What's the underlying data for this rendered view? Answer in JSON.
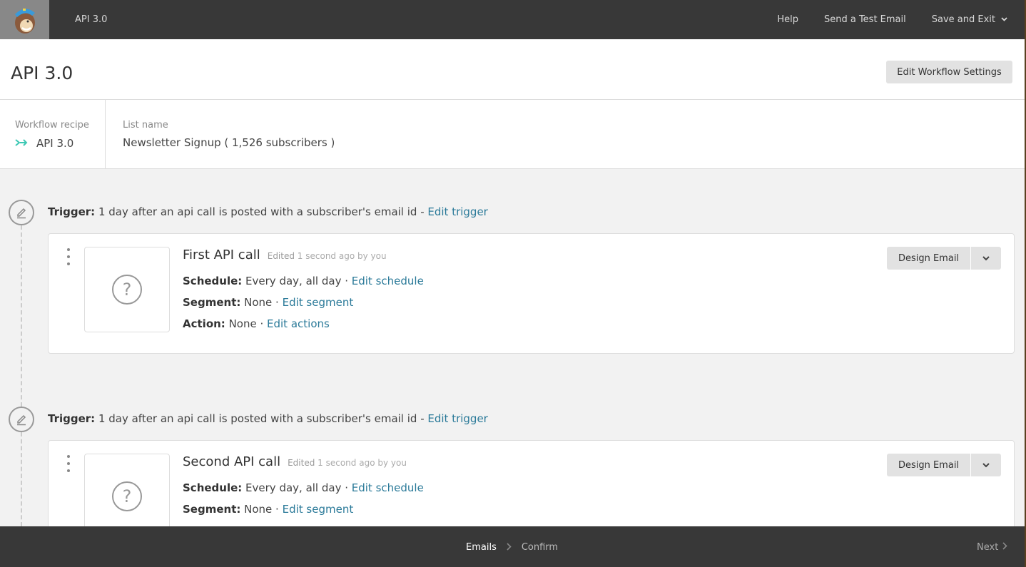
{
  "topbar": {
    "title": "API 3.0",
    "help": "Help",
    "send_test": "Send a Test Email",
    "save_exit": "Save and Exit",
    "save_exit_icon": "chevron-down-icon"
  },
  "header": {
    "title": "API 3.0",
    "edit_settings": "Edit Workflow Settings"
  },
  "info": {
    "recipe_label": "Workflow recipe",
    "recipe_value": "API 3.0",
    "list_label": "List name",
    "list_value": "Newsletter Signup ( 1,526 subscribers )"
  },
  "emails": [
    {
      "trigger_label": "Trigger:",
      "trigger_text": " 1 day after an api call is posted with a subscriber's email id - ",
      "trigger_link": "Edit trigger",
      "title": "First API call",
      "edited_prefix": "Edited",
      "edited_text": " 1 second ago by you",
      "schedule_label": "Schedule:",
      "schedule_value": " Every day, all day · ",
      "schedule_link": "Edit schedule",
      "segment_label": "Segment:",
      "segment_value": " None · ",
      "segment_link": "Edit segment",
      "action_label": "Action:",
      "action_value": " None · ",
      "action_link": "Edit actions",
      "design_label": "Design Email"
    },
    {
      "trigger_label": "Trigger:",
      "trigger_text": " 1 day after an api call is posted with a subscriber's email id - ",
      "trigger_link": "Edit trigger",
      "title": "Second API call",
      "edited_prefix": "Edited",
      "edited_text": " 1 second ago by you",
      "schedule_label": "Schedule:",
      "schedule_value": " Every day, all day · ",
      "schedule_link": "Edit schedule",
      "segment_label": "Segment:",
      "segment_value": " None · ",
      "segment_link": "Edit segment",
      "design_label": "Design Email"
    }
  ],
  "footer": {
    "step_emails": "Emails",
    "step_confirm": "Confirm",
    "next": "Next"
  }
}
